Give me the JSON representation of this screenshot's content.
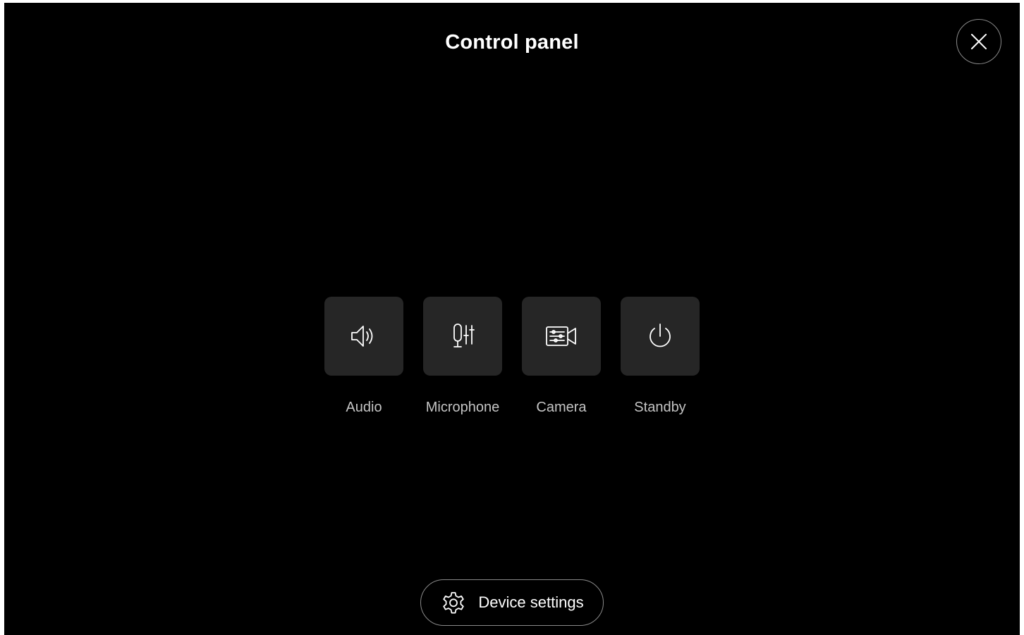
{
  "panel": {
    "title": "Control panel"
  },
  "icons": {
    "close": "close-icon",
    "settings": "gear-icon"
  },
  "tiles": [
    {
      "label": "Audio",
      "icon": "speaker-icon"
    },
    {
      "label": "Microphone",
      "icon": "microphone-settings-icon"
    },
    {
      "label": "Camera",
      "icon": "camera-settings-icon"
    },
    {
      "label": "Standby",
      "icon": "power-icon"
    }
  ],
  "footer": {
    "settings_label": "Device settings"
  },
  "colors": {
    "background": "#000000",
    "tile": "#262626",
    "text": "#ffffff",
    "label": "#c4c4c4",
    "outline": "#8a8a8a"
  }
}
